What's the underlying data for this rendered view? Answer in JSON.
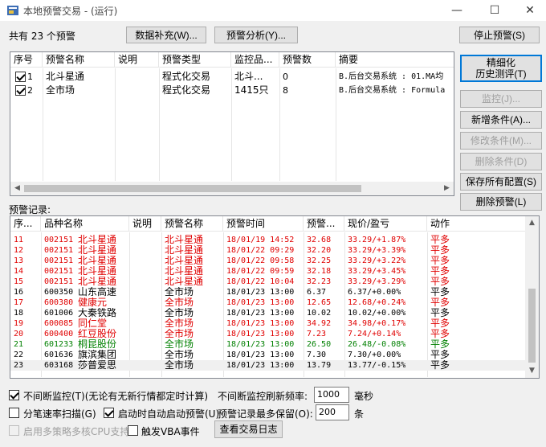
{
  "window": {
    "title": "本地预警交易 - (运行)",
    "minimize": "—",
    "maximize": "☐",
    "close": "✕"
  },
  "summary": "共有 23 个预警",
  "buttons": {
    "data_supplement": "数据补充(W)...",
    "alert_analysis": "预警分析(Y)...",
    "stop_alert": "停止预警(S)",
    "backtest_line1": "精细化",
    "backtest_line2": "历史测评(T)",
    "monitor": "监控(J)...",
    "add_condition": "新增条件(A)...",
    "modify_condition": "修改条件(M)...",
    "delete_condition": "删除条件(D)",
    "save_config": "保存所有配置(S)",
    "delete_alert": "删除预警(L)",
    "view_log": "查看交易日志"
  },
  "alerts_table": {
    "headers": [
      "序号",
      "预警名称",
      "说明",
      "预警类型",
      "监控品...",
      "预警数",
      "摘要"
    ],
    "rows": [
      {
        "checked": true,
        "no": "1",
        "name": "北斗星通",
        "desc": "",
        "type": "程式化交易",
        "monitor": "北斗...",
        "count": "0",
        "summary": "B.后台交易系统 : 01.MA均"
      },
      {
        "checked": true,
        "no": "2",
        "name": "全市场",
        "desc": "",
        "type": "程式化交易",
        "monitor": "1415只",
        "count": "8",
        "summary": "B.后台交易系统 : Formula"
      }
    ]
  },
  "records_label": "预警记录:",
  "records_table": {
    "headers": [
      "序...",
      "品种名称",
      "说明",
      "预警名称",
      "预警时间",
      "预警...",
      "现价/盈亏",
      "动作"
    ],
    "rows": [
      {
        "no": "11",
        "code": "002151",
        "name": "北斗星通",
        "desc": "",
        "alert": "北斗星通",
        "time": "18/01/19 14:52",
        "price": "32.68",
        "pnl": "33.29/+1.87%",
        "action": "平多",
        "color": "#e00000"
      },
      {
        "no": "12",
        "code": "002151",
        "name": "北斗星通",
        "desc": "",
        "alert": "北斗星通",
        "time": "18/01/22 09:29",
        "price": "32.20",
        "pnl": "33.29/+3.39%",
        "action": "平多",
        "color": "#e00000"
      },
      {
        "no": "13",
        "code": "002151",
        "name": "北斗星通",
        "desc": "",
        "alert": "北斗星通",
        "time": "18/01/22 09:58",
        "price": "32.25",
        "pnl": "33.29/+3.22%",
        "action": "平多",
        "color": "#e00000"
      },
      {
        "no": "14",
        "code": "002151",
        "name": "北斗星通",
        "desc": "",
        "alert": "北斗星通",
        "time": "18/01/22 09:59",
        "price": "32.18",
        "pnl": "33.29/+3.45%",
        "action": "平多",
        "color": "#e00000"
      },
      {
        "no": "15",
        "code": "002151",
        "name": "北斗星通",
        "desc": "",
        "alert": "北斗星通",
        "time": "18/01/22 10:04",
        "price": "32.23",
        "pnl": "33.29/+3.29%",
        "action": "平多",
        "color": "#e00000"
      },
      {
        "no": "16",
        "code": "600350",
        "name": "山东高速",
        "desc": "",
        "alert": "全市场",
        "time": "18/01/23 13:00",
        "price": "6.37",
        "pnl": "6.37/+0.00%",
        "action": "平多",
        "color": "#000000"
      },
      {
        "no": "17",
        "code": "600380",
        "name": "健康元",
        "desc": "",
        "alert": "全市场",
        "time": "18/01/23 13:00",
        "price": "12.65",
        "pnl": "12.68/+0.24%",
        "action": "平多",
        "color": "#e00000"
      },
      {
        "no": "18",
        "code": "601006",
        "name": "大秦铁路",
        "desc": "",
        "alert": "全市场",
        "time": "18/01/23 13:00",
        "price": "10.02",
        "pnl": "10.02/+0.00%",
        "action": "平多",
        "color": "#000000"
      },
      {
        "no": "19",
        "code": "600085",
        "name": "同仁堂",
        "desc": "",
        "alert": "全市场",
        "time": "18/01/23 13:00",
        "price": "34.92",
        "pnl": "34.98/+0.17%",
        "action": "平多",
        "color": "#e00000"
      },
      {
        "no": "20",
        "code": "600400",
        "name": "红豆股份",
        "desc": "",
        "alert": "全市场",
        "time": "18/01/23 13:00",
        "price": "7.23",
        "pnl": "7.24/+0.14%",
        "action": "平多",
        "color": "#e00000"
      },
      {
        "no": "21",
        "code": "601233",
        "name": "桐昆股份",
        "desc": "",
        "alert": "全市场",
        "time": "18/01/23 13:00",
        "price": "26.50",
        "pnl": "26.48/-0.08%",
        "action": "平多",
        "color": "#008000"
      },
      {
        "no": "22",
        "code": "601636",
        "name": "旗滨集团",
        "desc": "",
        "alert": "全市场",
        "time": "18/01/23 13:00",
        "price": "7.30",
        "pnl": "7.30/+0.00%",
        "action": "平多",
        "color": "#000000"
      },
      {
        "no": "23",
        "code": "603168",
        "name": "莎普爱思",
        "desc": "",
        "alert": "全市场",
        "time": "18/01/23 13:00",
        "price": "13.79",
        "pnl": "13.77/-0.15%",
        "action": "平多",
        "color": "#000000"
      }
    ]
  },
  "options": {
    "continuous_monitor": {
      "checked": true,
      "label": "不间断监控(T)(无论有无新行情都定时计算)"
    },
    "refresh_label": "不间断监控刷新频率:",
    "refresh_value": "1000",
    "refresh_unit": "毫秒",
    "tick_scan": {
      "checked": false,
      "label": "分笔速率扫描(G)"
    },
    "auto_start": {
      "checked": true,
      "label": "启动时自动启动预警(U)"
    },
    "max_records_label": "预警记录最多保留(O):",
    "max_records_value": "200",
    "max_records_unit": "条",
    "multicore": {
      "checked": false,
      "label": "启用多策略多核CPU支持"
    },
    "vba_event": {
      "checked": false,
      "label": "触发VBA事件"
    }
  }
}
